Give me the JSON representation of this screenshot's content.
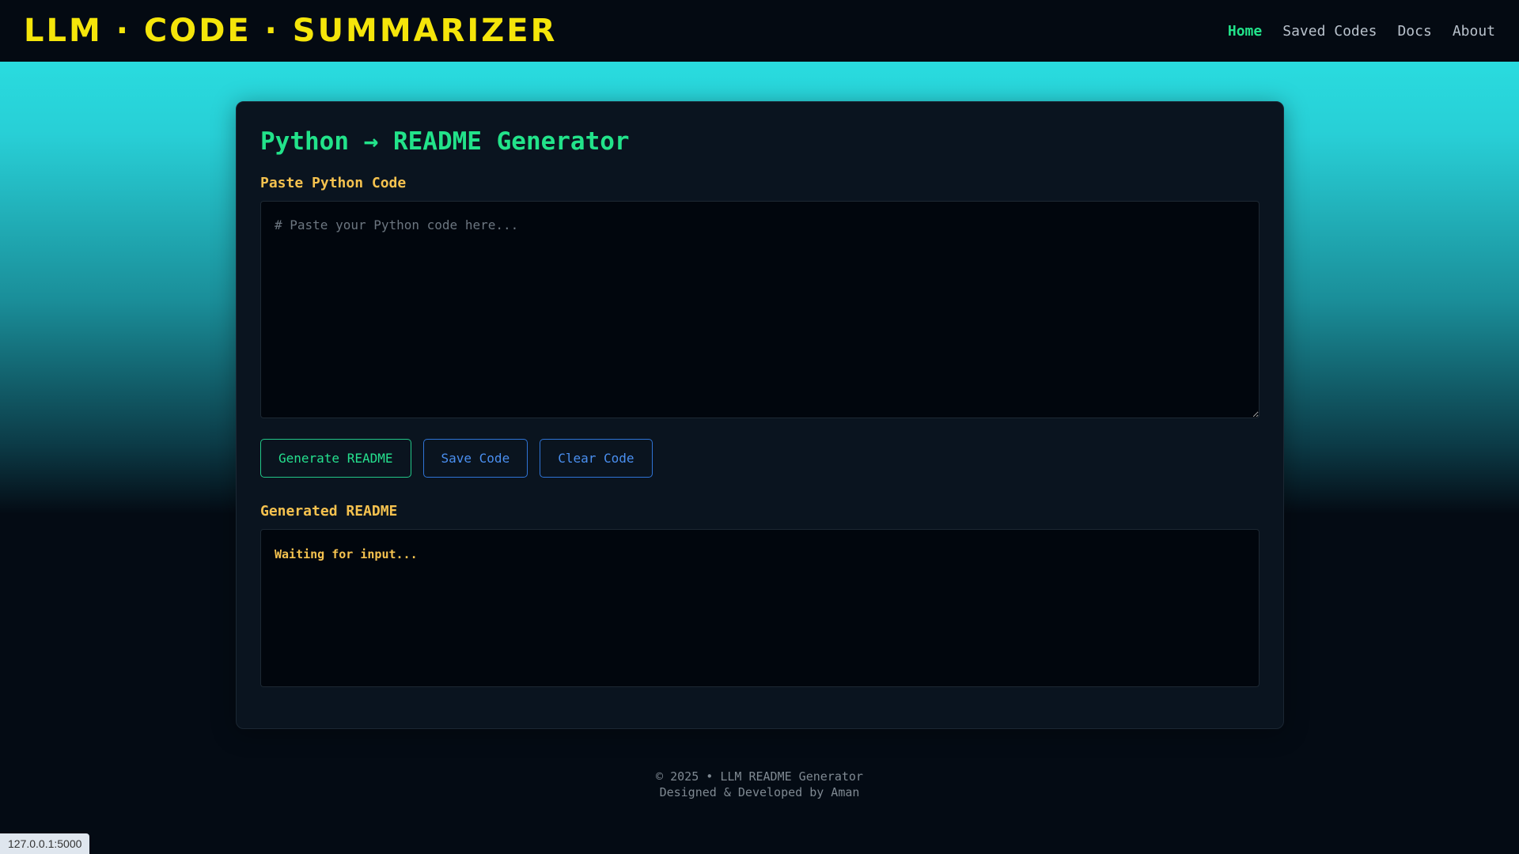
{
  "header": {
    "brand": "LLM · CODE · SUMMARIZER",
    "nav": [
      {
        "label": "Home"
      },
      {
        "label": "Saved Codes"
      },
      {
        "label": "Docs"
      },
      {
        "label": "About"
      }
    ],
    "active": "Home"
  },
  "main": {
    "title": "Python → README Generator",
    "input_label": "Paste Python Code",
    "input_placeholder": "# Paste your Python code here...",
    "input_value": "",
    "buttons": {
      "generate": "Generate README",
      "save": "Save Code",
      "clear": "Clear Code"
    },
    "output_label": "Generated README",
    "output_text": "Waiting for input..."
  },
  "footer": {
    "line1": "© 2025 • LLM README Generator",
    "line2": "Designed & Developed by Aman"
  },
  "status_bar": {
    "url": "127.0.0.1:5000"
  },
  "colors": {
    "brand": "#f5e50a",
    "accent_green": "#22e38a",
    "label_amber": "#f5c24f",
    "button_blue": "#4a8ff0"
  }
}
